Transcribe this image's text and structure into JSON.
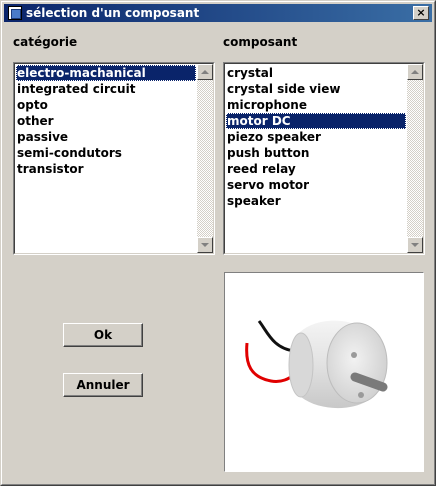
{
  "window": {
    "title": "sélection d'un composant",
    "close_label": "×"
  },
  "categories": {
    "label": "catégorie",
    "selected": "electro-machanical",
    "items": [
      {
        "label": "electro-machanical"
      },
      {
        "label": "integrated circuit"
      },
      {
        "label": "opto"
      },
      {
        "label": "other"
      },
      {
        "label": "passive"
      },
      {
        "label": "semi-condutors"
      },
      {
        "label": "transistor"
      }
    ]
  },
  "components": {
    "label": "composant",
    "selected": "motor DC",
    "items": [
      {
        "label": "crystal"
      },
      {
        "label": "crystal side view"
      },
      {
        "label": "microphone"
      },
      {
        "label": "motor DC"
      },
      {
        "label": "piezo speaker"
      },
      {
        "label": "push button"
      },
      {
        "label": "reed relay"
      },
      {
        "label": "servo motor"
      },
      {
        "label": "speaker"
      }
    ]
  },
  "buttons": {
    "ok_label": "Ok",
    "cancel_label": "Annuler"
  },
  "preview": {
    "component_icon": "dc-motor-icon",
    "colors": {
      "wire_black": "#111111",
      "wire_red": "#e00000",
      "body": "#dcdcdc",
      "shaft": "#7a7a7a"
    }
  },
  "colors": {
    "selection": "#0a246a",
    "titlebar_start": "#0a246a",
    "titlebar_end": "#3a6ea5",
    "face": "#d4d0c8"
  }
}
